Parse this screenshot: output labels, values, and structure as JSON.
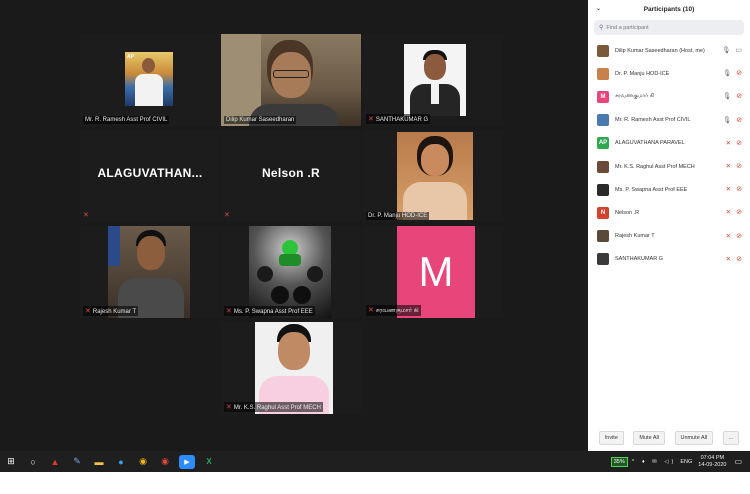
{
  "video_tiles": [
    {
      "name": "Mr. R. Ramesh Asst Prof CIVIL",
      "muted": false
    },
    {
      "name": "Dilip Kumar Saseedharan",
      "muted": false,
      "active": true
    },
    {
      "name": "SANTHAKUMAR G",
      "muted": true
    },
    {
      "display": "ALAGUVATHAN...",
      "muted": true
    },
    {
      "display": "Nelson .R",
      "muted": true
    },
    {
      "name": "Dr. P. Manju HOD-ICE",
      "muted": false
    },
    {
      "name": "Rajesh Kumar T",
      "muted": true
    },
    {
      "name": "Ms. P. Swapna Asst Prof EEE",
      "muted": true
    },
    {
      "name": "சரவணகுமார் கி",
      "avatar_letter": "M",
      "muted": true
    },
    {
      "name": "Mr. K.S. Raghul Asst Prof MECH",
      "muted": true
    }
  ],
  "panel": {
    "title": "Participants (10)",
    "search_placeholder": "Find a participant",
    "participants": [
      {
        "name": "Dilip Kumar Saseedharan (Host, me)",
        "avatar_color": "#7a5a3a",
        "avatar_letter": "",
        "mic": "on",
        "cam": "on"
      },
      {
        "name": "Dr. P. Manju HOD-ICE",
        "avatar_color": "#c9804a",
        "avatar_letter": "",
        "mic": "on",
        "cam": "off"
      },
      {
        "name": "சரவணகுமார் கி",
        "avatar_color": "#e8457b",
        "avatar_letter": "M",
        "mic": "on",
        "cam": "off"
      },
      {
        "name": "Mr. R. Ramesh Asst Prof CIVIL",
        "avatar_color": "#4a7ab0",
        "avatar_letter": "",
        "mic": "on",
        "cam": "off"
      },
      {
        "name": "ALAGUVATHANA PARAVEL",
        "avatar_color": "#2fa84f",
        "avatar_letter": "AP",
        "mic": "off",
        "cam": "off"
      },
      {
        "name": "Mr. K.S. Raghul Asst Prof MECH",
        "avatar_color": "#6b4a3a",
        "avatar_letter": "",
        "mic": "off",
        "cam": "off"
      },
      {
        "name": "Ms. P. Swapna Asst Prof EEE",
        "avatar_color": "#2a2a2a",
        "avatar_letter": "",
        "mic": "off",
        "cam": "off"
      },
      {
        "name": "Nelson .R",
        "avatar_color": "#d0432f",
        "avatar_letter": "N",
        "mic": "off",
        "cam": "off"
      },
      {
        "name": "Rajesh Kumar T",
        "avatar_color": "#5a4a3a",
        "avatar_letter": "",
        "mic": "off",
        "cam": "off"
      },
      {
        "name": "SANTHAKUMAR G",
        "avatar_color": "#3a3a3a",
        "avatar_letter": "",
        "mic": "off",
        "cam": "off"
      }
    ],
    "buttons": {
      "invite": "Invite",
      "mute_all": "Mute All",
      "unmute_all": "Unmute All",
      "more": "..."
    }
  },
  "taskbar": {
    "battery": "35%",
    "lang": "ENG",
    "time": "07:04 PM",
    "date": "14-09-2020"
  }
}
